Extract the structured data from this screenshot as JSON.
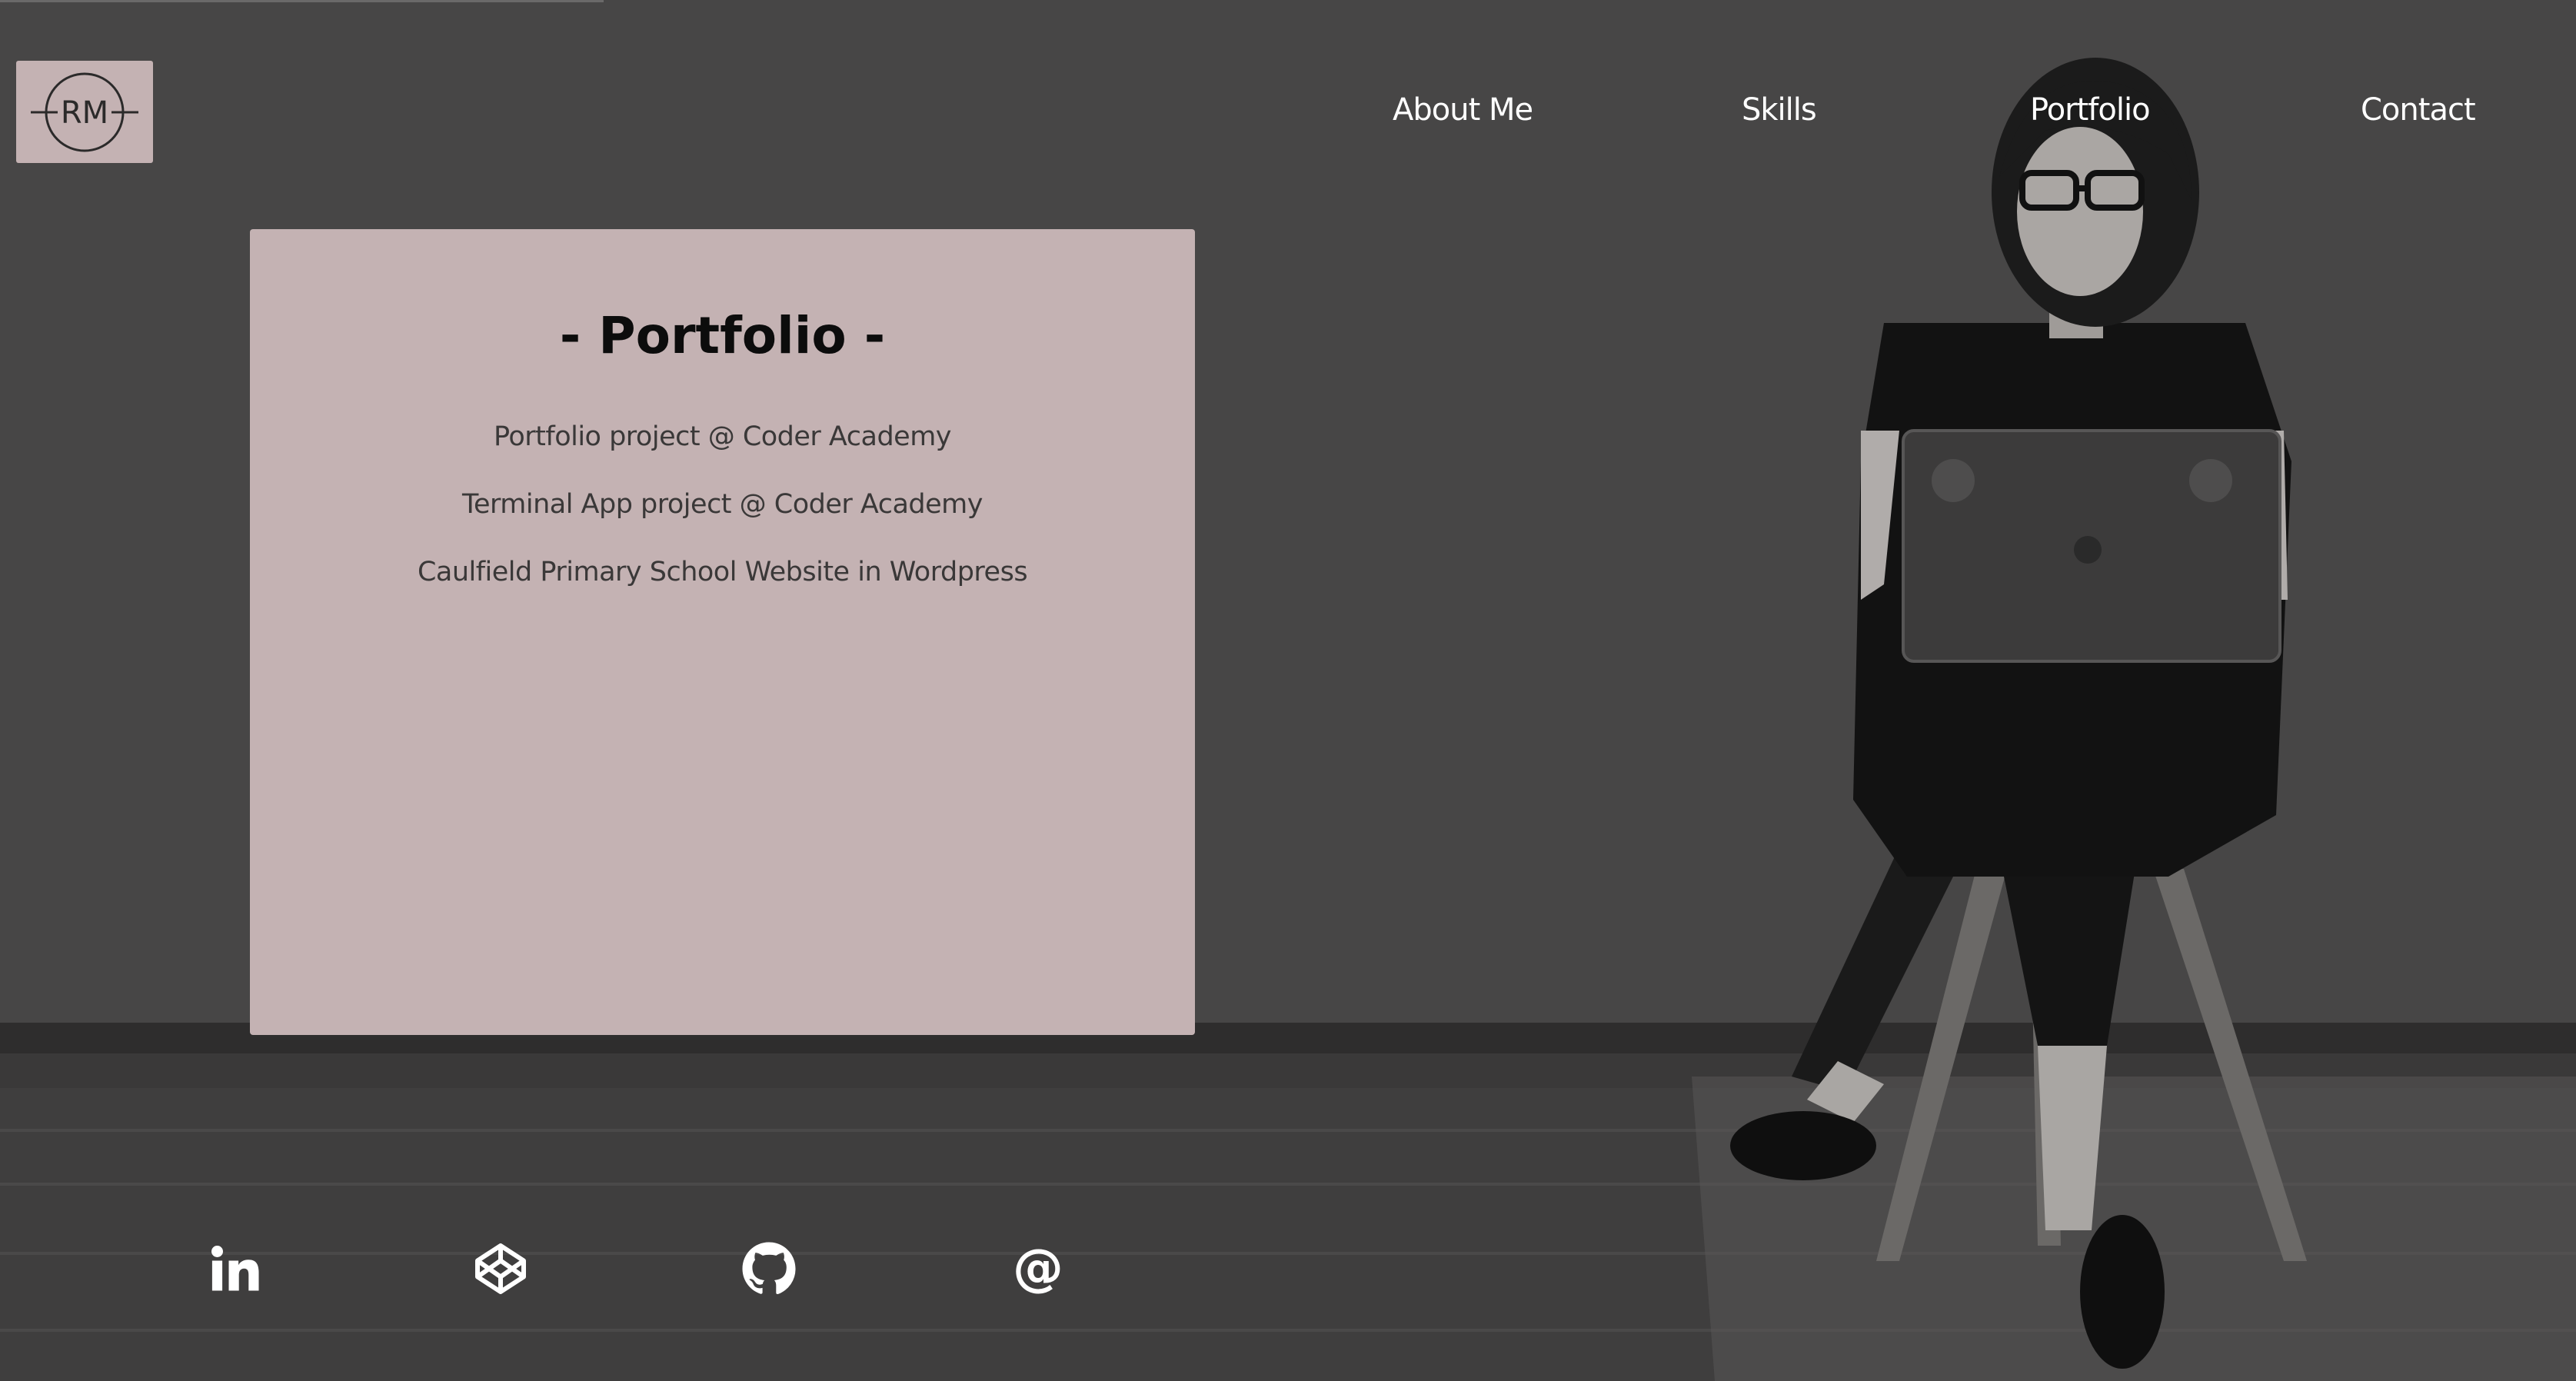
{
  "colors": {
    "background": "#474646",
    "card": "#c4b2b3",
    "nav_text": "#ffffff",
    "heading": "#0c0c0c",
    "body_text": "#3a3838"
  },
  "logo": {
    "text": "RM",
    "icon": "rm-monogram-logo"
  },
  "nav": {
    "items": [
      {
        "label": "About Me"
      },
      {
        "label": "Skills"
      },
      {
        "label": "Portfolio"
      },
      {
        "label": "Contact"
      }
    ]
  },
  "portfolio": {
    "title": "- Portfolio -",
    "projects": [
      {
        "label": "Portfolio project @ Coder Academy"
      },
      {
        "label": "Terminal App project @ Coder Academy"
      },
      {
        "label": "Caulfield Primary School Website in Wordpress"
      }
    ]
  },
  "social": {
    "icons": [
      "linkedin-icon",
      "codepen-icon",
      "github-icon",
      "email-at-icon"
    ]
  },
  "background_photo": "woman-seated-on-stool-with-laptop"
}
